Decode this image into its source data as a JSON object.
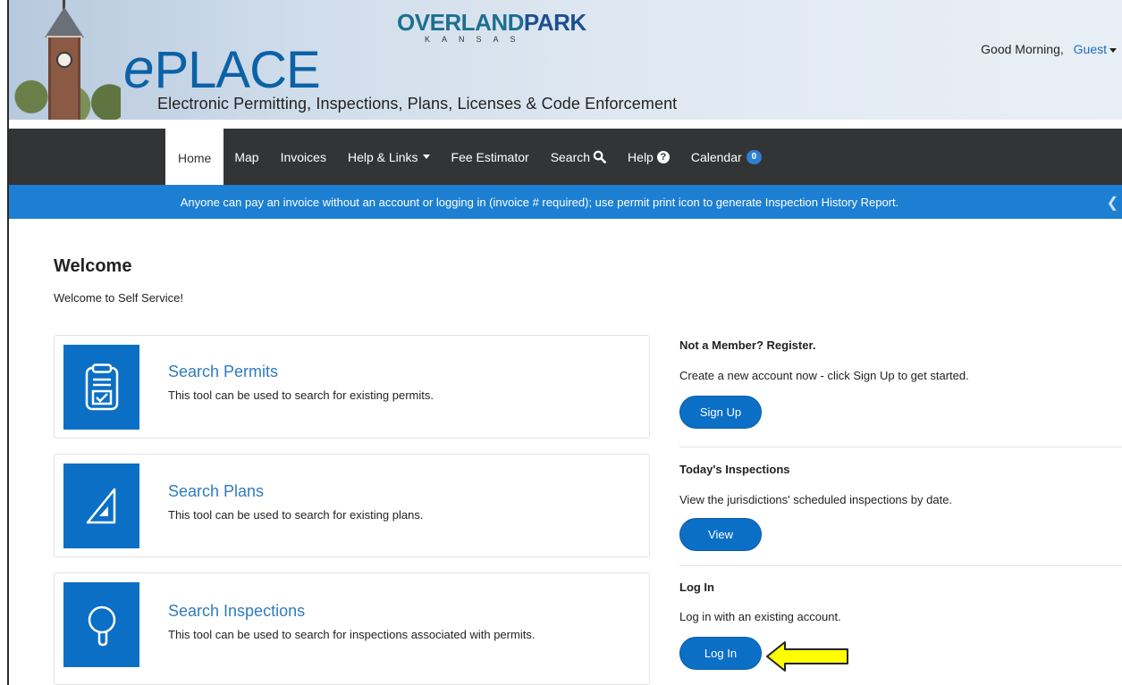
{
  "header": {
    "logo_overland": "OVERLAND",
    "logo_park": "PARK",
    "logo_kansas": "KANSAS",
    "logo_e": "e",
    "logo_place": "PLACE",
    "tagline": "Electronic Permitting, Inspections, Plans, Licenses & Code Enforcement",
    "greeting": "Good Morning,",
    "user": "Guest"
  },
  "nav": {
    "home": "Home",
    "map": "Map",
    "invoices": "Invoices",
    "help_links": "Help & Links",
    "fee_estimator": "Fee Estimator",
    "search": "Search",
    "help": "Help",
    "calendar": "Calendar",
    "calendar_count": "0"
  },
  "banner": {
    "text": "Anyone can pay an invoice without an account or logging in (invoice # required); use permit print icon to generate Inspection History Report."
  },
  "welcome": {
    "title": "Welcome",
    "subtitle": "Welcome to Self Service!"
  },
  "cards": [
    {
      "title": "Search Permits",
      "desc": "This tool can be used to search for existing permits.",
      "icon": "clipboard-check-icon"
    },
    {
      "title": "Search Plans",
      "desc": "This tool can be used to search for existing plans.",
      "icon": "set-square-icon"
    },
    {
      "title": "Search Inspections",
      "desc": "This tool can be used to search for inspections associated with permits.",
      "icon": "magnifier-icon"
    }
  ],
  "register": {
    "title": "Not a Member? Register.",
    "text": "Create a new account now - click Sign Up to get started.",
    "button": "Sign Up"
  },
  "inspections": {
    "title": "Today's Inspections",
    "text": "View the jurisdictions' scheduled inspections by date.",
    "button": "View"
  },
  "login": {
    "title": "Log In",
    "text": "Log in with an existing account.",
    "button": "Log In"
  },
  "colors": {
    "brand_blue": "#0b6fc6",
    "banner_blue": "#1d7fd1",
    "nav_dark": "#333436",
    "arrow_yellow": "#ffff00"
  }
}
